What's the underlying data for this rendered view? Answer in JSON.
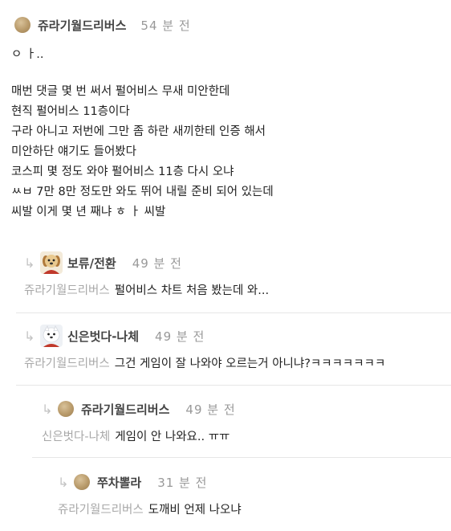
{
  "post": {
    "author": "쥬라기월드리버스",
    "time": "54 분 전",
    "lines": [
      "ㅇ ㅏ..",
      "",
      "매번 댓글 몇 번 써서 펄어비스 무새 미안한데",
      "현직 펄어비스 11층이다",
      "구라 아니고 저번에 그만 좀 하란 새끼한테 인증 해서",
      "미안하단 얘기도 들어봤다",
      "코스피 몇 정도 와야 펄어비스 11층 다시 오냐",
      "ㅆㅂ 7만 8만 정도만 와도 뛰어 내릴 준비 되어 있는데",
      "씨발 이게 몇 년 째냐 ㅎ ㅏ 씨발"
    ]
  },
  "replies": [
    {
      "author": "보류/전환",
      "time": "49 분 전",
      "mention": "쥬라기월드리버스",
      "text": "펄어비스 차트 처음 봤는데 와...",
      "avatar": "puppy-avatar"
    },
    {
      "author": "신은벗다-나체",
      "time": "49 분 전",
      "mention": "쥬라기월드리버스",
      "text": "그건 게임이 잘 나와야 오르는거 아니냐?ㅋㅋㅋㅋㅋㅋㅋ",
      "avatar": "white-dog-avatar"
    },
    {
      "author": "쥬라기월드리버스",
      "time": "49 분 전",
      "mention": "신은벗다-나체",
      "text": "게임이 안 나와요.. ㅠㅠ",
      "avatar": "circle-avatar"
    },
    {
      "author": "쭈차뽈라",
      "time": "31 분 전",
      "mention": "쥬라기월드리버스",
      "text": "도깨비 언제 나오냐",
      "avatar": "circle-avatar"
    }
  ],
  "reply_arrow_icon": "reply-arrow-icon",
  "colors": {
    "nickname": "#444444",
    "time": "#999999",
    "mention": "#a8a8a8",
    "separator": "#e6e6e6"
  }
}
